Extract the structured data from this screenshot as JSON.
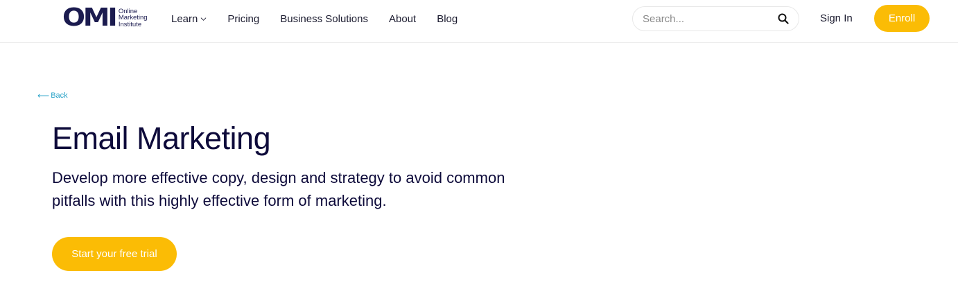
{
  "header": {
    "logo": {
      "mark": "OMI",
      "line1": "Online",
      "line2": "Marketing",
      "line3": "Institute"
    },
    "nav": [
      "Learn",
      "Pricing",
      "Business Solutions",
      "About",
      "Blog"
    ],
    "search_placeholder": "Search...",
    "signin": "Sign In",
    "enroll": "Enroll"
  },
  "main": {
    "back": "Back",
    "title": "Email Marketing",
    "subtitle": "Develop more effective copy, design and strategy to avoid common pitfalls with this highly effective form of marketing.",
    "cta": "Start your free trial"
  },
  "colors": {
    "accent": "#fbbc05",
    "brand": "#1b1b4f",
    "link": "#2aa3c8",
    "text": "#0d0a3a"
  },
  "icons": [
    "chevron-down-icon",
    "search-icon",
    "arrow-left-icon"
  ]
}
